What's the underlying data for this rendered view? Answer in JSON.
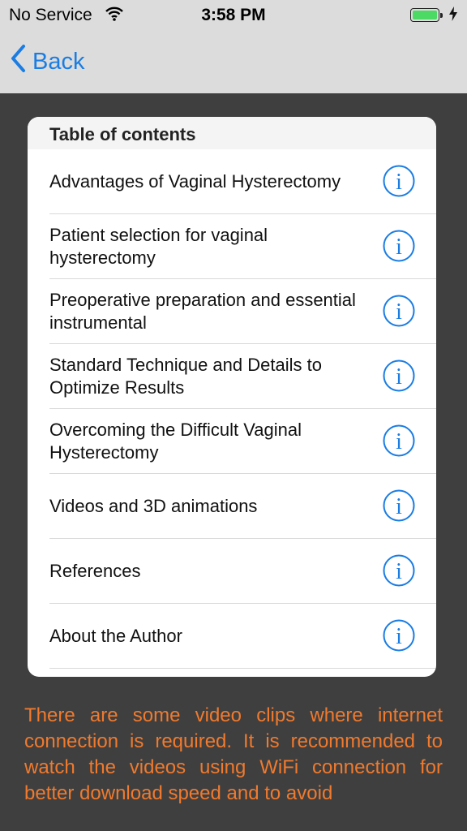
{
  "status_bar": {
    "carrier": "No Service",
    "time": "3:58 PM",
    "battery_color": "#4cd964"
  },
  "nav": {
    "back_label": "Back",
    "accent_color": "#1a7de3"
  },
  "toc": {
    "header": "Table of contents",
    "items": [
      {
        "label": "Advantages of Vaginal Hysterectomy",
        "icon": "info-icon"
      },
      {
        "label": "Patient selection for vaginal hysterectomy",
        "icon": "info-icon"
      },
      {
        "label": "Preoperative preparation and essential instrumental",
        "icon": "info-icon"
      },
      {
        "label": "Standard Technique and Details to Optimize Results",
        "icon": "info-icon"
      },
      {
        "label": "Overcoming the Difficult Vaginal Hysterectomy",
        "icon": "info-icon"
      },
      {
        "label": "Videos and 3D animations",
        "icon": "info-icon"
      },
      {
        "label": "References",
        "icon": "info-icon"
      },
      {
        "label": "About the Author",
        "icon": "info-icon"
      }
    ]
  },
  "notice": {
    "text": "There are some video clips where internet connection is required. It is recommended to watch the videos using WiFi connection for better download speed and to avoid",
    "color": "#f07a2e"
  }
}
